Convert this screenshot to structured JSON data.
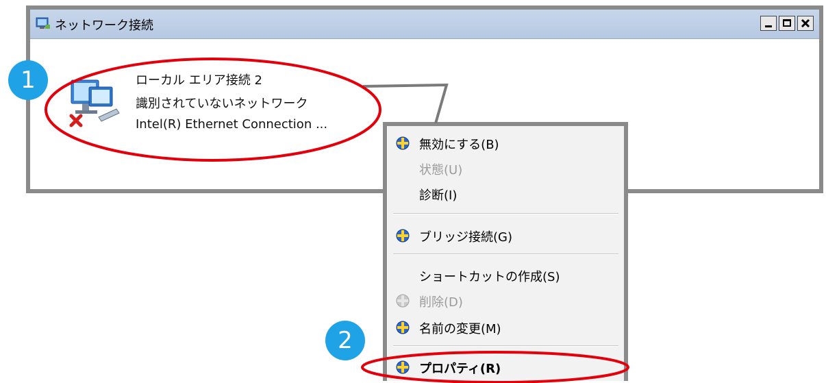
{
  "window": {
    "title": "ネットワーク接続",
    "buttons": [
      "_",
      "□",
      "x"
    ]
  },
  "connection": {
    "name": "ローカル エリア接続 2",
    "status": "識別されていないネットワーク",
    "adapter": "Intel(R) Ethernet Connection ...",
    "icon": "network-disconnected-icon"
  },
  "context_menu": {
    "items": [
      {
        "label": "無効にする(B)",
        "shield": true,
        "disabled": false
      },
      {
        "label": "状態(U)",
        "shield": false,
        "disabled": true
      },
      {
        "label": "診断(I)",
        "shield": false,
        "disabled": false
      },
      {
        "label": "ブリッジ接続(G)",
        "shield": true,
        "disabled": false
      },
      {
        "label": "ショートカットの作成(S)",
        "shield": false,
        "disabled": false
      },
      {
        "label": "削除(D)",
        "shield": true,
        "disabled": true
      },
      {
        "label": "名前の変更(M)",
        "shield": true,
        "disabled": false
      },
      {
        "label": "プロパティ(R)",
        "shield": true,
        "disabled": false,
        "bold": true
      }
    ]
  },
  "annotations": {
    "step1": "1",
    "step2": "2",
    "highlight_color": "#e3000b",
    "badge_color": "#1fa3e6"
  }
}
